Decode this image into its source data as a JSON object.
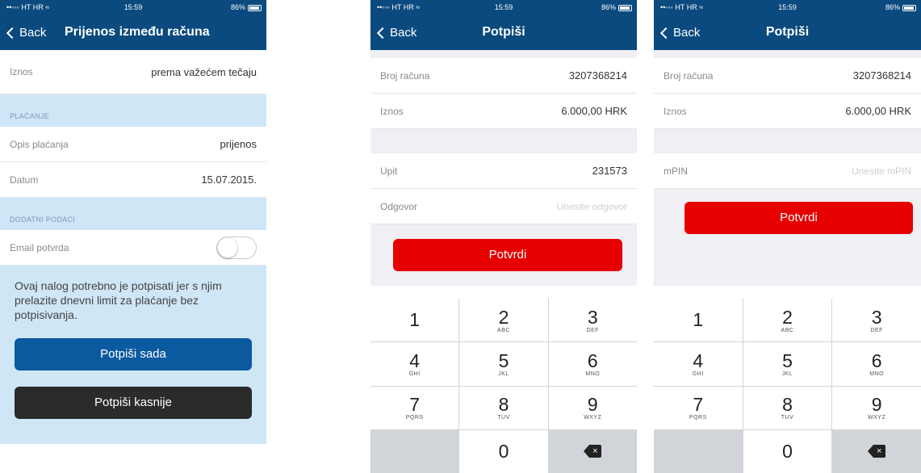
{
  "statusbar": {
    "carrier": "••◦◦◦ HT HR ≈",
    "time": "15:59",
    "battery": "86%"
  },
  "screen1": {
    "back_label": "Back",
    "title": "Prijenos između računa",
    "amount_label": "Iznos",
    "amount_value": "prema važećem tečaju",
    "section_payment": "PLAĆANJE",
    "desc_label": "Opis plaćanja",
    "desc_value": "prijenos",
    "date_label": "Datum",
    "date_value": "15.07.2015.",
    "section_additional": "DODATNI PODACI",
    "email_label": "Email potvrda",
    "email_toggle_on": false,
    "info_text": "Ovaj nalog potrebno je potpisati jer s njim prelazite dnevni limit za plaćanje bez potpisivanja.",
    "sign_now_label": "Potpiši sada",
    "sign_later_label": "Potpiši kasnije"
  },
  "screen2": {
    "back_label": "Back",
    "title": "Potpiši",
    "account_label": "Broj računa",
    "account_value": "3207368214",
    "amount_label": "Iznos",
    "amount_value": "6.000,00 HRK",
    "query_label": "Upit",
    "query_value": "231573",
    "answer_label": "Odgovor",
    "answer_placeholder": "Unesite odgovor",
    "confirm_label": "Potvrdi"
  },
  "screen3": {
    "back_label": "Back",
    "title": "Potpiši",
    "account_label": "Broj računa",
    "account_value": "3207368214",
    "amount_label": "Iznos",
    "amount_value": "6.000,00 HRK",
    "mpin_label": "mPIN",
    "mpin_placeholder": "Unesite mPIN",
    "confirm_label": "Potvrdi"
  },
  "keypad": [
    {
      "num": "1",
      "letters": ""
    },
    {
      "num": "2",
      "letters": "ABC"
    },
    {
      "num": "3",
      "letters": "DEF"
    },
    {
      "num": "4",
      "letters": "GHI"
    },
    {
      "num": "5",
      "letters": "JKL"
    },
    {
      "num": "6",
      "letters": "MNO"
    },
    {
      "num": "7",
      "letters": "PQRS"
    },
    {
      "num": "8",
      "letters": "TUV"
    },
    {
      "num": "9",
      "letters": "WXYZ"
    },
    {
      "num": "0",
      "letters": ""
    }
  ],
  "colors": {
    "nav_bar": "#0a4a7e",
    "section_bg": "#cfe6f6",
    "primary_button": "#0b5aa0",
    "secondary_button": "#2b2b2b",
    "confirm_button": "#e60000"
  }
}
